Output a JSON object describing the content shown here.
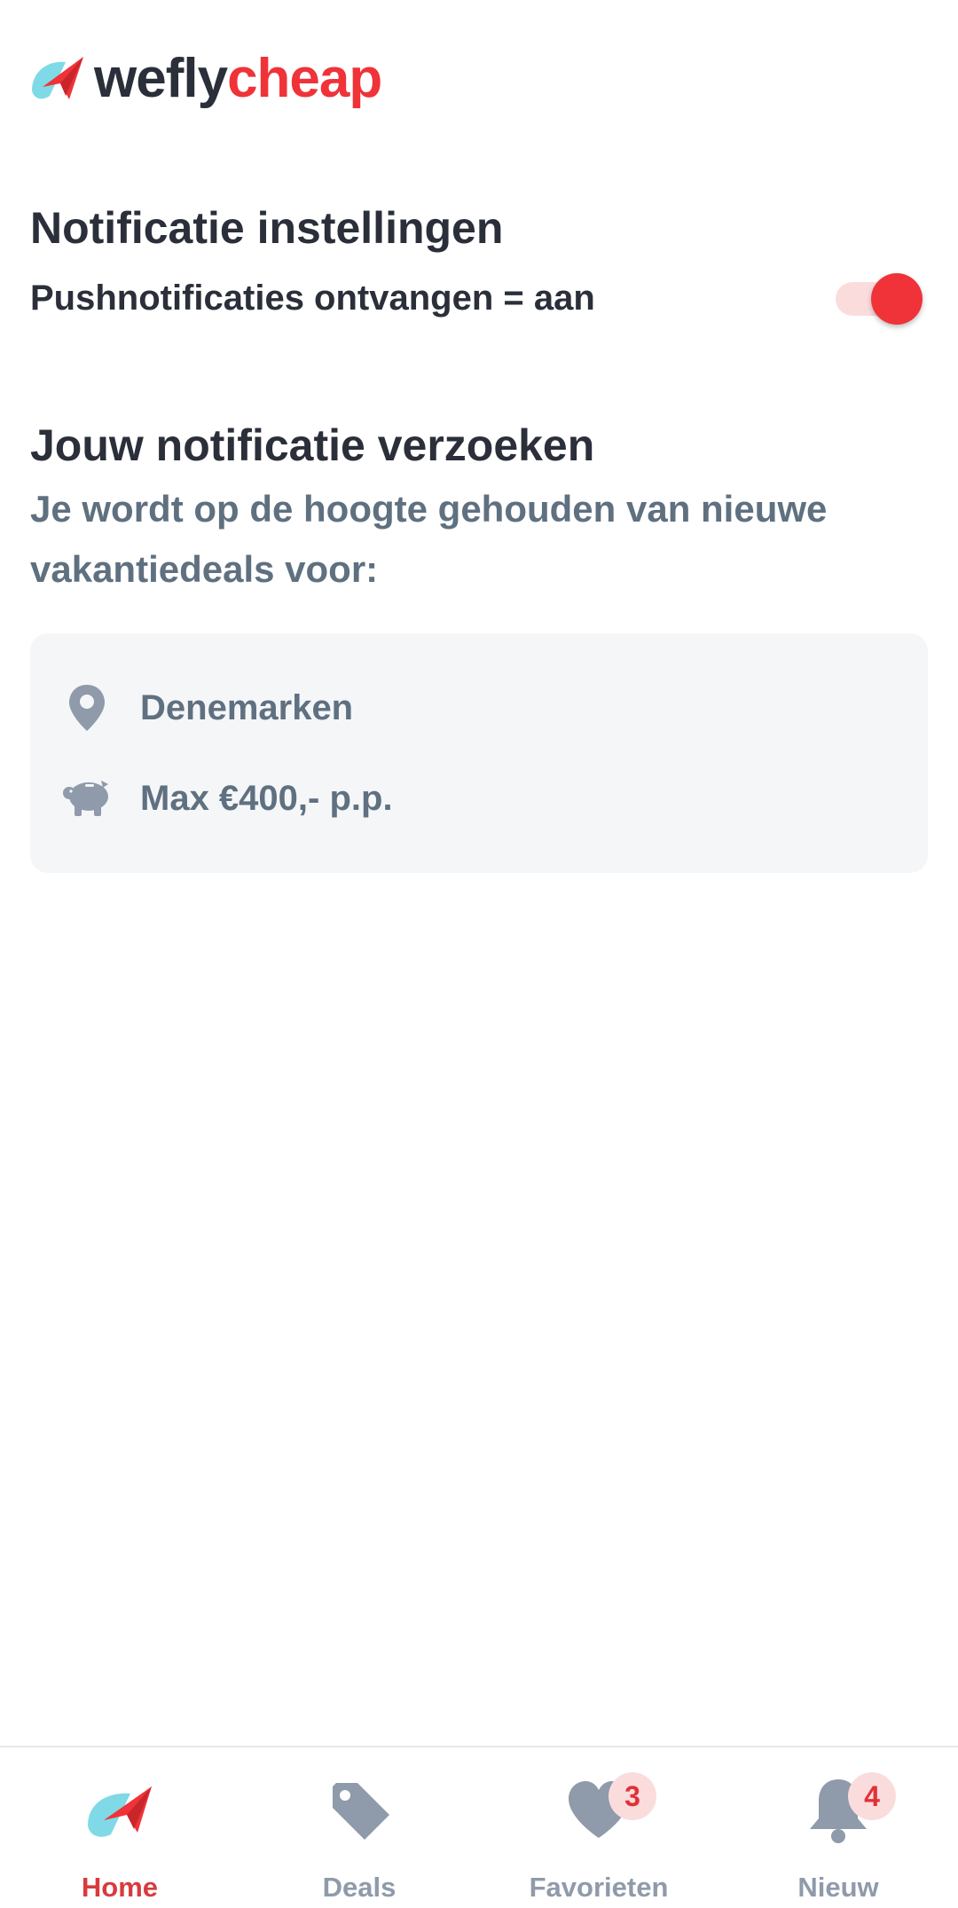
{
  "logo": {
    "part1": "wefly",
    "part2": "cheap",
    "icon": "plane-logo-icon"
  },
  "notification_settings": {
    "title": "Notificatie instellingen",
    "push_label": "Pushnotificaties ontvangen = aan",
    "push_enabled": true
  },
  "requests": {
    "title": "Jouw notificatie verzoeken",
    "subtitle": "Je wordt op de hoogte gehouden van nieuwe vakantiedeals voor:",
    "items": [
      {
        "icon": "location-pin-icon",
        "label": "Denemarken"
      },
      {
        "icon": "piggy-bank-icon",
        "label": "Max €400,- p.p."
      }
    ]
  },
  "bottom_nav": {
    "items": [
      {
        "label": "Home",
        "icon": "plane-logo-icon",
        "active": true
      },
      {
        "label": "Deals",
        "icon": "tag-icon",
        "active": false
      },
      {
        "label": "Favorieten",
        "icon": "heart-icon",
        "badge": "3",
        "active": false
      },
      {
        "label": "Nieuw",
        "icon": "bell-icon",
        "badge": "4",
        "active": false
      }
    ]
  },
  "colors": {
    "brand_red": "#ef3338",
    "brand_cyan": "#7fd9e6",
    "text_dark": "#2a2f3a",
    "text_muted": "#5f7080",
    "icon_gray": "#8f9aaa"
  }
}
